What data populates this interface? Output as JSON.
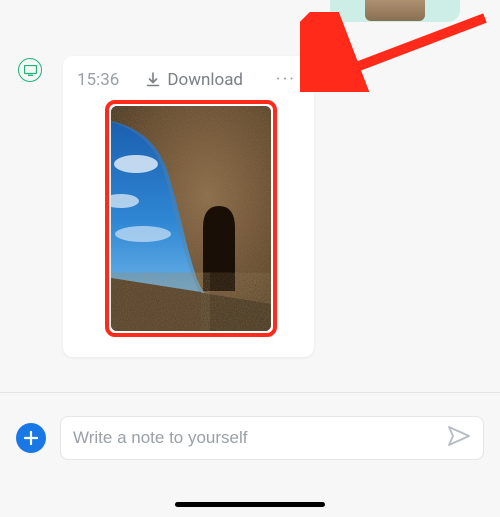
{
  "previous_message": {
    "thumb_alt": "previous-image-thumbnail"
  },
  "device_indicator": {
    "name": "desktop-origin-icon"
  },
  "message": {
    "timestamp": "15:36",
    "download_label": "Download",
    "image_alt": "stone-ruin-arch-photo"
  },
  "compose": {
    "placeholder": "Write a note to yourself",
    "value": ""
  },
  "icons": {
    "more": "···"
  },
  "annotation": {
    "arrow_color": "#ff2a1a",
    "highlight_color": "#ff2a1a"
  }
}
